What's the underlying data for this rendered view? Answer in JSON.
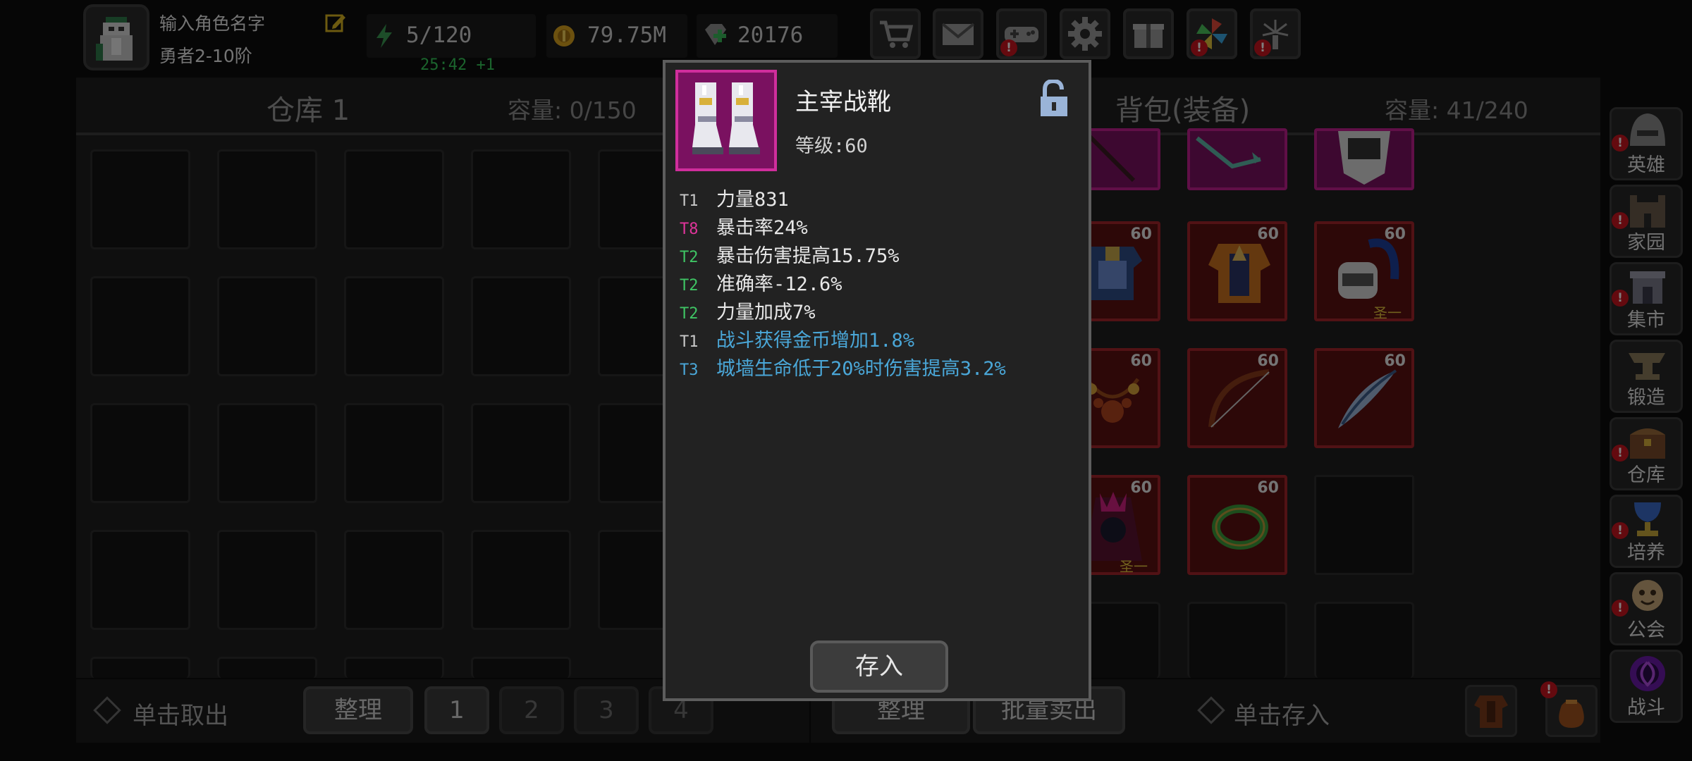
{
  "player": {
    "name": "输入角色名字",
    "rank": "勇者2-10阶",
    "energy": "5/120",
    "timer": "25:42 +1",
    "gold": "79.75M",
    "gems": "20176"
  },
  "colors": {
    "tier_gray": "#c8c8c8",
    "tier_pink": "#e0349b",
    "tier_green": "#3fc464",
    "tier_blue": "#4aa7d8",
    "attr_text": "#e8e8e8",
    "attr_special": "#4aa7d8"
  },
  "top_buttons": [
    {
      "icon": "shop-cart-icon",
      "badge": ""
    },
    {
      "icon": "mail-icon",
      "badge": ""
    },
    {
      "icon": "gamepad-icon",
      "badge": "!"
    },
    {
      "icon": "gear-icon",
      "badge": ""
    },
    {
      "icon": "gift-icon",
      "badge": ""
    },
    {
      "icon": "pinwheel-icon",
      "badge": "!"
    },
    {
      "icon": "fireworks-icon",
      "badge": "!"
    }
  ],
  "warehouse": {
    "title": "仓库 1",
    "capacity": "容量: 0/150"
  },
  "backpack": {
    "title": "背包(装备)",
    "capacity": "容量: 41/240",
    "level_labels": [
      "60",
      "60",
      "60",
      "60",
      "60",
      "60",
      "60",
      "60",
      "60",
      "60",
      "60"
    ],
    "set_label": "圣一"
  },
  "bottom_left": {
    "hint": "单击取出",
    "sort": "整理",
    "pages": [
      "1",
      "2",
      "3",
      "4"
    ]
  },
  "bottom_right": {
    "sort": "整理",
    "bulk_sell": "批量卖出",
    "hint": "单击存入"
  },
  "nav": [
    {
      "label": "英雄",
      "icon": "helmet-icon"
    },
    {
      "label": "家园",
      "icon": "castle-icon"
    },
    {
      "label": "集市",
      "icon": "market-icon"
    },
    {
      "label": "锻造",
      "icon": "anvil-icon"
    },
    {
      "label": "仓库",
      "icon": "chest-icon"
    },
    {
      "label": "培养",
      "icon": "chalice-icon"
    },
    {
      "label": "公会",
      "icon": "guild-icon"
    },
    {
      "label": "战斗",
      "icon": "portal-icon"
    }
  ],
  "item_popup": {
    "name": "主宰战靴",
    "level": "等级:60",
    "attributes": [
      {
        "tier": "T1",
        "text": "力量831"
      },
      {
        "tier": "T8",
        "text": "暴击率24%"
      },
      {
        "tier": "T2",
        "text": "暴击伤害提高15.75%"
      },
      {
        "tier": "T2",
        "text": "准确率-12.6%"
      },
      {
        "tier": "T2",
        "text": "力量加成7%"
      },
      {
        "tier": "T1",
        "text": "战斗获得金币增加1.8%"
      },
      {
        "tier": "T3",
        "text": "城墙生命低于20%时伤害提高3.2%"
      }
    ],
    "store_button": "存入"
  }
}
